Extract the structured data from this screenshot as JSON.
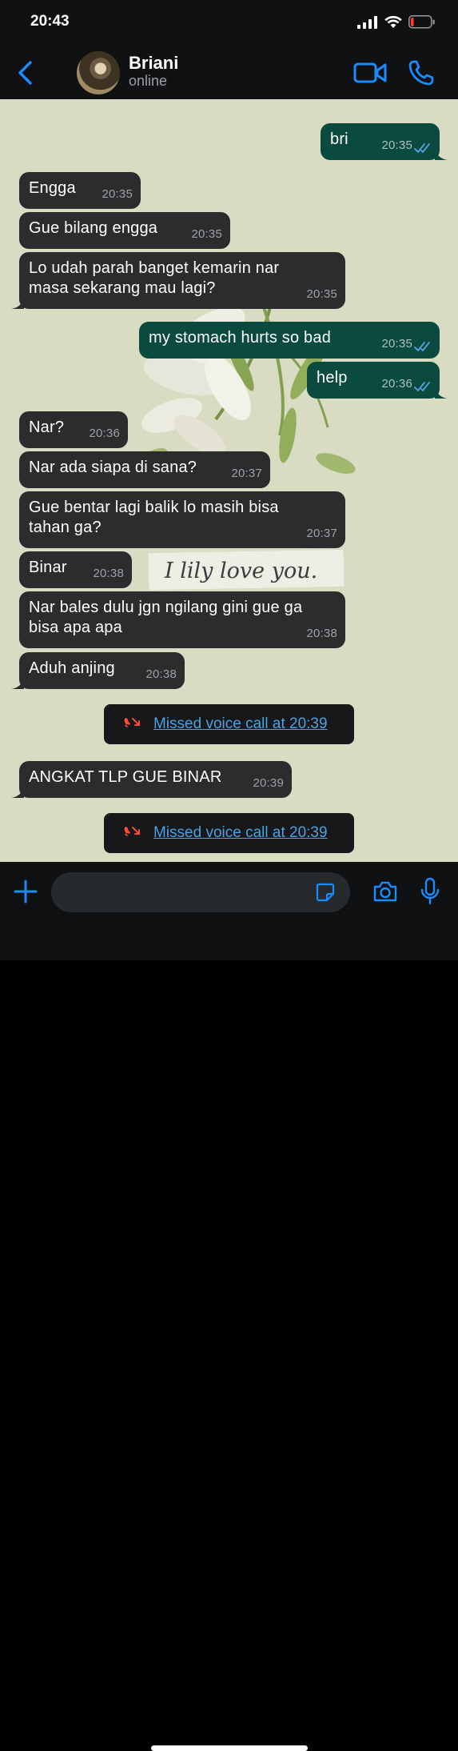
{
  "status_bar": {
    "time": "20:43",
    "battery_level": 0.15,
    "battery_color": "#ff3b30"
  },
  "header": {
    "contact_name": "Briani",
    "contact_status": "online"
  },
  "accent_color": "#1a8cff",
  "wallpaper_text": "I lily love you.",
  "messages": [
    {
      "direction": "out",
      "lines": [
        "bri"
      ],
      "time": "20:35",
      "read": true
    },
    {
      "direction": "in",
      "lines": [
        "Engga"
      ],
      "time": "20:35"
    },
    {
      "direction": "in",
      "lines": [
        "Gue bilang engga"
      ],
      "time": "20:35"
    },
    {
      "direction": "in",
      "lines": [
        "Lo udah parah banget kemarin nar",
        "masa sekarang mau lagi?"
      ],
      "time": "20:35"
    },
    {
      "direction": "out",
      "lines": [
        "my stomach hurts so bad"
      ],
      "time": "20:35",
      "read": true
    },
    {
      "direction": "out",
      "lines": [
        "help"
      ],
      "time": "20:36",
      "read": true
    },
    {
      "direction": "in",
      "lines": [
        "Nar?"
      ],
      "time": "20:36"
    },
    {
      "direction": "in",
      "lines": [
        "Nar ada siapa di sana?"
      ],
      "time": "20:37"
    },
    {
      "direction": "in",
      "lines": [
        "Gue bentar lagi balik lo masih bisa",
        "tahan ga?"
      ],
      "time": "20:37"
    },
    {
      "direction": "in",
      "lines": [
        "Binar"
      ],
      "time": "20:38"
    },
    {
      "direction": "in",
      "lines": [
        "Nar bales dulu jgn ngilang gini gue ga",
        "bisa apa apa"
      ],
      "time": "20:38"
    },
    {
      "direction": "in",
      "lines": [
        "Aduh anjing"
      ],
      "time": "20:38"
    },
    {
      "type": "missed_call",
      "text": "Missed voice call at 20:39"
    },
    {
      "direction": "in",
      "lines": [
        "ANGKAT TLP GUE BINAR"
      ],
      "time": "20:39"
    },
    {
      "type": "missed_call",
      "text": "Missed voice call at 20:39"
    }
  ],
  "input": {
    "value": "",
    "placeholder": ""
  },
  "icons": {
    "back": "chevron-left-icon",
    "video": "video-camera-icon",
    "phone": "phone-icon",
    "plus": "plus-icon",
    "sticker": "sticker-icon",
    "camera": "camera-icon",
    "mic": "microphone-icon",
    "missed_call": "missed-call-icon",
    "read_ticks": "double-check-icon"
  }
}
